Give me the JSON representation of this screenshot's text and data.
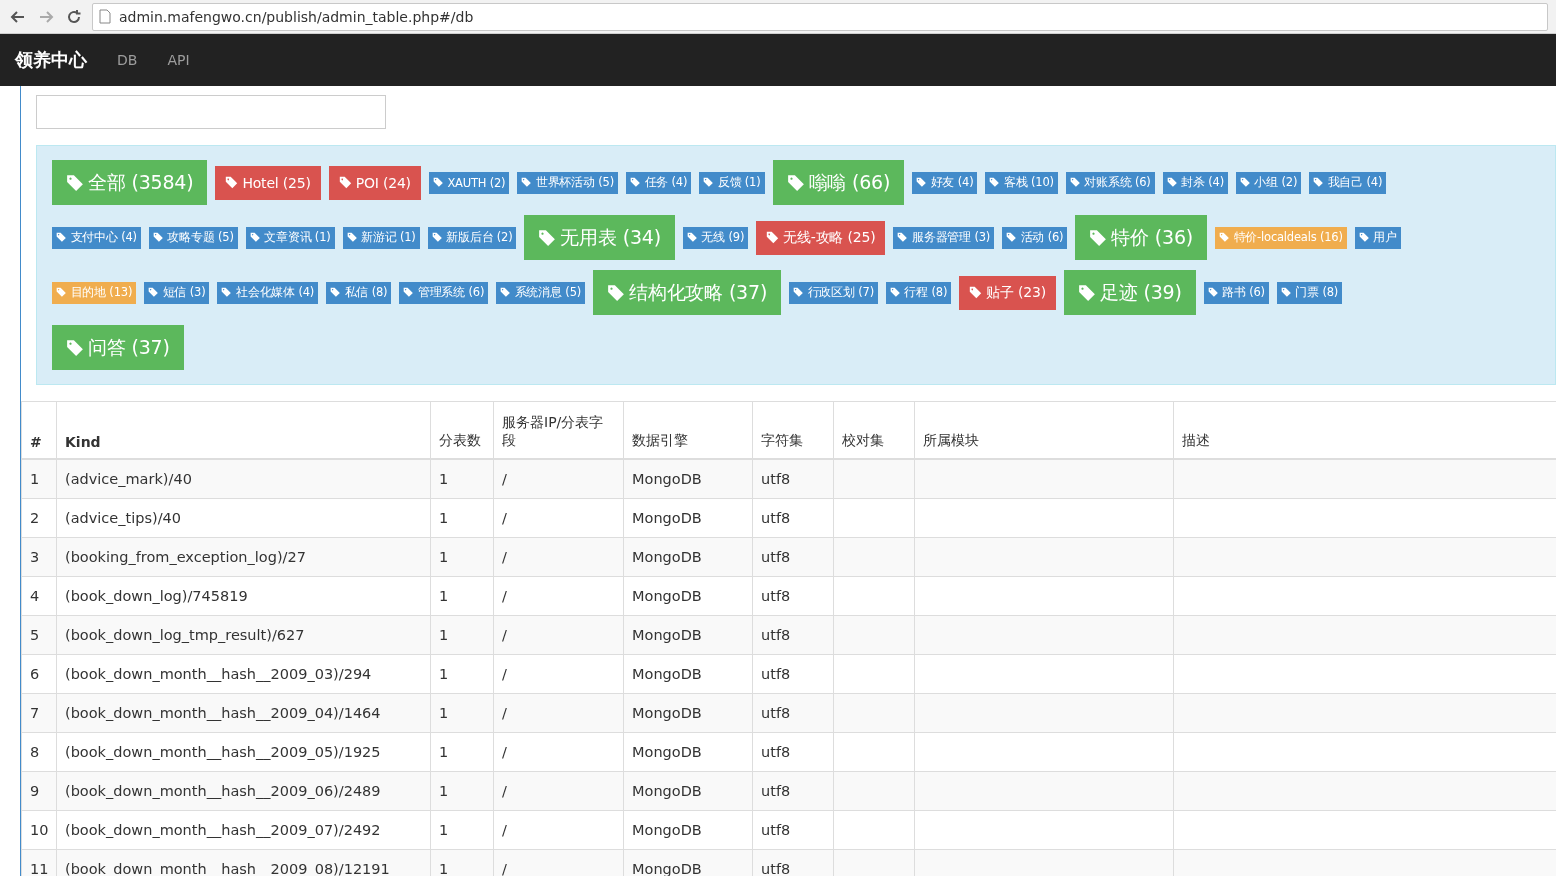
{
  "browser": {
    "url": "admin.mafengwo.cn/publish/admin_table.php#/db"
  },
  "navbar": {
    "brand": "领养中心",
    "links": [
      {
        "label": "DB"
      },
      {
        "label": "API"
      }
    ]
  },
  "tag_rows": [
    [
      {
        "label": "全部 (3584)",
        "kind": "large",
        "color": "#5cb85c"
      },
      {
        "label": "Hotel (25)",
        "kind": "medium",
        "color": "#d9534f"
      },
      {
        "label": "POI (24)",
        "kind": "medium",
        "color": "#d9534f"
      },
      {
        "label": "XAUTH (2)",
        "kind": "small",
        "color": "#428bca"
      },
      {
        "label": "世界杯活动 (5)",
        "kind": "small",
        "color": "#428bca"
      },
      {
        "label": "任务 (4)",
        "kind": "small",
        "color": "#428bca"
      },
      {
        "label": "反馈 (1)",
        "kind": "small",
        "color": "#428bca"
      },
      {
        "label": "嗡嗡 (66)",
        "kind": "large",
        "color": "#5cb85c"
      },
      {
        "label": "好友 (4)",
        "kind": "small",
        "color": "#428bca"
      },
      {
        "label": "客栈 (10)",
        "kind": "small",
        "color": "#428bca"
      },
      {
        "label": "对账系统 (6)",
        "kind": "small",
        "color": "#428bca"
      },
      {
        "label": "封杀 (4)",
        "kind": "small",
        "color": "#428bca"
      },
      {
        "label": "小组 (2)",
        "kind": "small",
        "color": "#428bca"
      },
      {
        "label": "我自己 (4)",
        "kind": "small",
        "color": "#428bca"
      }
    ],
    [
      {
        "label": "支付中心 (4)",
        "kind": "small",
        "color": "#428bca"
      },
      {
        "label": "攻略专题 (5)",
        "kind": "small",
        "color": "#428bca"
      },
      {
        "label": "文章资讯 (1)",
        "kind": "small",
        "color": "#428bca"
      },
      {
        "label": "新游记 (1)",
        "kind": "small",
        "color": "#428bca"
      },
      {
        "label": "新版后台 (2)",
        "kind": "small",
        "color": "#428bca"
      },
      {
        "label": "无用表 (34)",
        "kind": "large",
        "color": "#5cb85c"
      },
      {
        "label": "无线 (9)",
        "kind": "small",
        "color": "#428bca"
      },
      {
        "label": "无线-攻略 (25)",
        "kind": "medium",
        "color": "#d9534f"
      },
      {
        "label": "服务器管理 (3)",
        "kind": "small",
        "color": "#428bca"
      },
      {
        "label": "活动 (6)",
        "kind": "small",
        "color": "#428bca"
      },
      {
        "label": "特价 (36)",
        "kind": "large",
        "color": "#5cb85c"
      },
      {
        "label": "特价-localdeals (16)",
        "kind": "small",
        "color": "#f0ad4e"
      },
      {
        "label": "用户",
        "kind": "small",
        "color": "#428bca"
      }
    ],
    [
      {
        "label": "目的地 (13)",
        "kind": "small",
        "color": "#f0ad4e"
      },
      {
        "label": "短信 (3)",
        "kind": "small",
        "color": "#428bca"
      },
      {
        "label": "社会化媒体 (4)",
        "kind": "small",
        "color": "#428bca"
      },
      {
        "label": "私信 (8)",
        "kind": "small",
        "color": "#428bca"
      },
      {
        "label": "管理系统 (6)",
        "kind": "small",
        "color": "#428bca"
      },
      {
        "label": "系统消息 (5)",
        "kind": "small",
        "color": "#428bca"
      },
      {
        "label": "结构化攻略 (37)",
        "kind": "large",
        "color": "#5cb85c"
      },
      {
        "label": "行政区划 (7)",
        "kind": "small",
        "color": "#428bca"
      },
      {
        "label": "行程 (8)",
        "kind": "small",
        "color": "#428bca"
      },
      {
        "label": "贴子 (23)",
        "kind": "medium",
        "color": "#d9534f"
      },
      {
        "label": "足迹 (39)",
        "kind": "large",
        "color": "#5cb85c"
      },
      {
        "label": "路书 (6)",
        "kind": "small",
        "color": "#428bca"
      },
      {
        "label": "门票 (8)",
        "kind": "small",
        "color": "#428bca"
      }
    ],
    [
      {
        "label": "问答 (37)",
        "kind": "large",
        "color": "#5cb85c"
      }
    ]
  ],
  "table": {
    "columns": [
      "#",
      "Kind",
      "分表数",
      "服务器IP/分表字段",
      "数据引擎",
      "字符集",
      "校对集",
      "所属模块",
      "描述"
    ],
    "rows": [
      [
        "1",
        "(advice_mark)/40",
        "1",
        "/",
        "MongoDB",
        "utf8"
      ],
      [
        "2",
        "(advice_tips)/40",
        "1",
        "/",
        "MongoDB",
        "utf8"
      ],
      [
        "3",
        "(booking_from_exception_log)/27",
        "1",
        "/",
        "MongoDB",
        "utf8"
      ],
      [
        "4",
        "(book_down_log)/745819",
        "1",
        "/",
        "MongoDB",
        "utf8"
      ],
      [
        "5",
        "(book_down_log_tmp_result)/627",
        "1",
        "/",
        "MongoDB",
        "utf8"
      ],
      [
        "6",
        "(book_down_month__hash__2009_03)/294",
        "1",
        "/",
        "MongoDB",
        "utf8"
      ],
      [
        "7",
        "(book_down_month__hash__2009_04)/1464",
        "1",
        "/",
        "MongoDB",
        "utf8"
      ],
      [
        "8",
        "(book_down_month__hash__2009_05)/1925",
        "1",
        "/",
        "MongoDB",
        "utf8"
      ],
      [
        "9",
        "(book_down_month__hash__2009_06)/2489",
        "1",
        "/",
        "MongoDB",
        "utf8"
      ],
      [
        "10",
        "(book_down_month__hash__2009_07)/2492",
        "1",
        "/",
        "MongoDB",
        "utf8"
      ],
      [
        "11",
        "(book_down_month__hash__2009_08)/12191",
        "1",
        "/",
        "MongoDB",
        "utf8"
      ]
    ]
  }
}
